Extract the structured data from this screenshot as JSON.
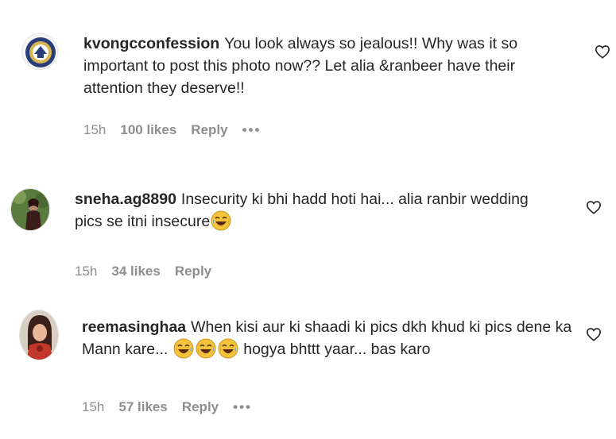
{
  "comments": [
    {
      "username": "kvongcconfession",
      "text": "You look always so jealous!! Why was it so important to post this photo now?? Let alia &ranbeer have their attention they deserve!!",
      "time": "15h",
      "likes": "100 likes",
      "reply": "Reply",
      "more": "•••",
      "avatar_icon": "circular-seal-logo",
      "colors": {
        "avatar_ring": "#2a3f7a",
        "avatar_fill": "#d9b650"
      }
    },
    {
      "username": "sneha.ag8890",
      "text": "Insecurity ki bhi hadd hoti hai... alia ranbir wedding pics se itni insecure",
      "time": "15h",
      "likes": "34 likes",
      "reply": "Reply",
      "avatar_icon": "profile-photo",
      "colors": {
        "avatar_bg": "#5b7b3e",
        "avatar_person": "#3a1d1a"
      }
    },
    {
      "username": "reemasinghaa",
      "text_before": "When kisi aur ki shaadi ki pics dkh khud ki pics dene ka Mann kare...",
      "text_after": "hogya bhttt yaar... bas karo",
      "time": "15h",
      "likes": "57 likes",
      "reply": "Reply",
      "more": "•••",
      "avatar_icon": "profile-photo",
      "colors": {
        "avatar_bg": "#c4372b",
        "avatar_face": "#e8b79a"
      }
    }
  ],
  "icons": {
    "like": "heart-outline-icon",
    "emoji": "face-with-tears-of-joy-emoji"
  },
  "colors": {
    "text": "#262626",
    "meta": "#8e8e8e",
    "background": "#ffffff"
  }
}
